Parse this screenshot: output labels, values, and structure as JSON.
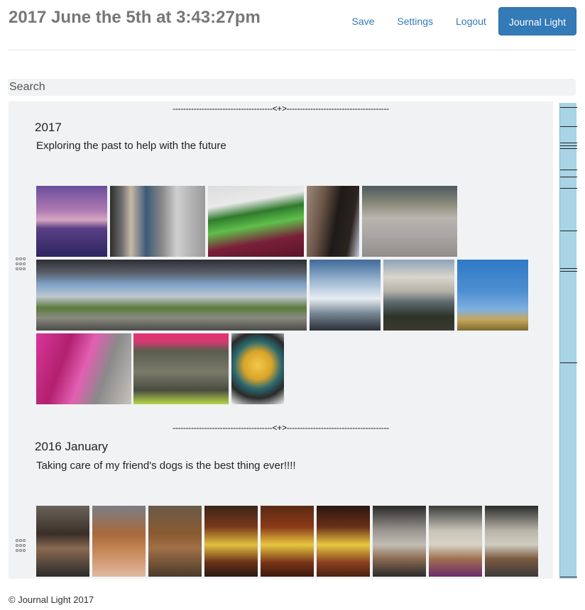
{
  "header": {
    "title": "2017 June the 5th at 3:43:27pm",
    "nav": {
      "save": "Save",
      "settings": "Settings",
      "logout": "Logout",
      "brand": "Journal Light"
    }
  },
  "search": {
    "placeholder": "Search",
    "value": ""
  },
  "entries": [
    {
      "separator": "--------------------------------------<+>---------------------------------------",
      "title": "2017",
      "text": "Exploring the past to help with the future",
      "photo_count": 12
    },
    {
      "separator": "--------------------------------------<+>---------------------------------------",
      "title": "2016 January",
      "text": "Taking care of my friend's dogs is the best thing ever!!!!",
      "photo_count": 9
    }
  ],
  "footer": {
    "copyright": "© Journal Light 2017"
  },
  "colors": {
    "accent": "#337ab7",
    "panel": "#f1f2f4",
    "scrollbar": "#a9d4e6",
    "title": "#777777"
  },
  "icons": {
    "drag_handle": "drag-handle-icon"
  }
}
